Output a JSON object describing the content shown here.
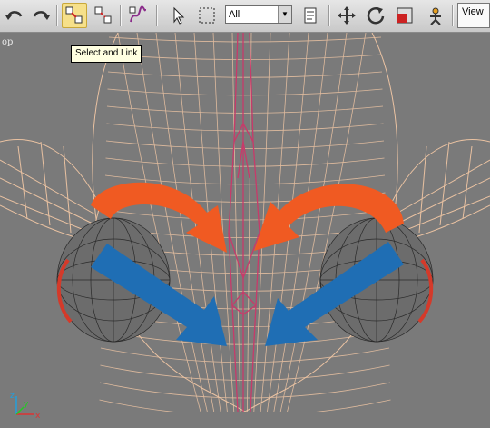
{
  "toolbar": {
    "buttons": [
      {
        "name": "undo-icon"
      },
      {
        "name": "redo-icon"
      },
      {
        "name": "select-and-link-icon",
        "active": true
      },
      {
        "name": "unlink-selection-icon"
      },
      {
        "name": "bind-to-space-warp-icon"
      },
      {
        "name": "select-object-icon"
      },
      {
        "name": "rectangular-selection-icon"
      },
      {
        "name": "select-by-name-icon"
      },
      {
        "name": "select-and-move-icon"
      },
      {
        "name": "select-and-rotate-icon"
      },
      {
        "name": "select-and-scale-icon"
      },
      {
        "name": "select-and-manipulate-icon"
      }
    ],
    "selection_filter": "All",
    "reference_coord": "View"
  },
  "tooltip": "Select and Link",
  "viewport": {
    "label": "op",
    "wire_color": "#f0c6a4",
    "selected_wire_color": "#c83a6a",
    "arrow_orange": "#f05a22",
    "arrow_blue": "#1f6eb4",
    "axis_labels": {
      "x": "x",
      "y": "y",
      "z": "z"
    }
  }
}
